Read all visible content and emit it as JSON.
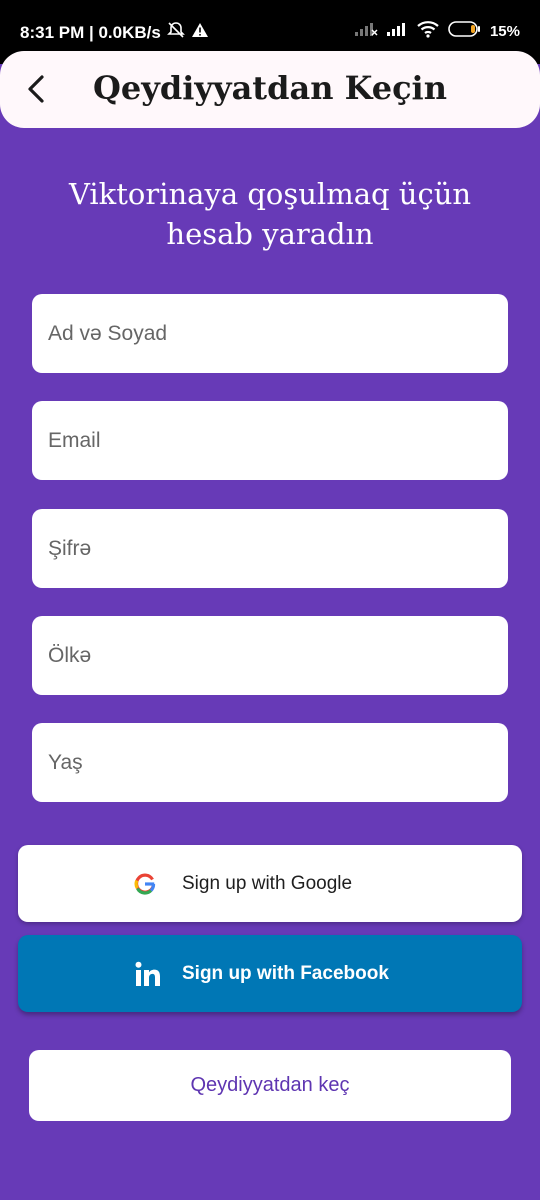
{
  "status_bar": {
    "time_speed": "8:31 PM | 0.0KB/s",
    "battery": "15%"
  },
  "app_bar": {
    "title": "Qeydiyyatdan Keçin"
  },
  "headline": {
    "line1": "Viktorinaya qoşulmaq üçün",
    "line2": "hesab yaradın"
  },
  "form": {
    "full_name_placeholder": "Ad və Soyad",
    "email_placeholder": "Email",
    "password_placeholder": "Şifrə",
    "country_placeholder": "Ölkə",
    "age_placeholder": "Yaş"
  },
  "buttons": {
    "google_label": "Sign up with Google",
    "facebook_label": "Sign up with Facebook",
    "register_label": "Qeydiyyatdan keç"
  },
  "colors": {
    "background": "#673AB7",
    "linkedin_blue": "#0077B5",
    "accent_text": "#5E35B1"
  }
}
